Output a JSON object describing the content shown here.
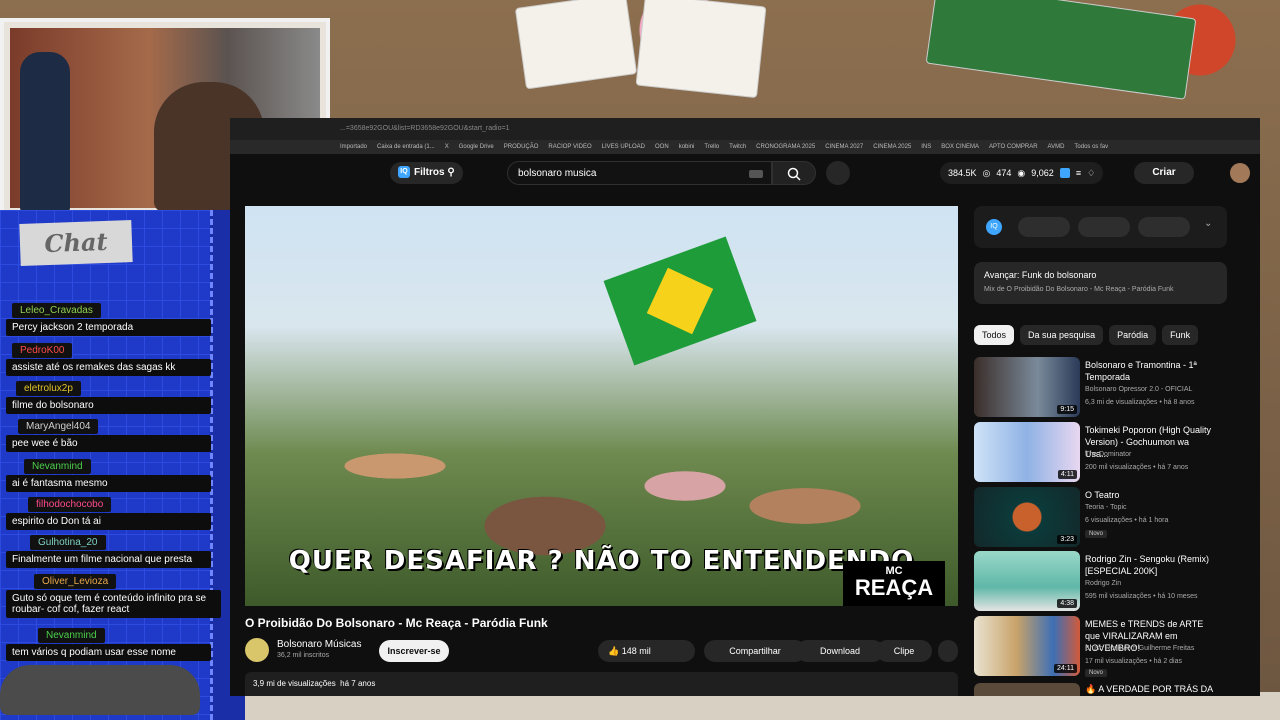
{
  "chat": {
    "title": "Chat",
    "messages": [
      {
        "user": "Leleo_Cravadas",
        "text": "Percy jackson 2 temporada",
        "color": "#8fd14f"
      },
      {
        "user": "PedroK00",
        "text": "assiste até os remakes das sagas kk",
        "color": "#ff4b4b"
      },
      {
        "user": "eletrolux2p",
        "text": "filme do bolsonaro",
        "color": "#e0c22c"
      },
      {
        "user": "MaryAngel404",
        "text": "pee wee é bão",
        "color": "#cfcfcf"
      },
      {
        "user": "Nevanmind",
        "text": "ai é fantasma mesmo",
        "color": "#4bd14b"
      },
      {
        "user": "filhodochocobo",
        "text": "espirito do Don tá ai",
        "color": "#ff4b8c"
      },
      {
        "user": "Gulhotina_20",
        "text": "Finalmente um filme nacional que presta",
        "color": "#7fd1c1"
      },
      {
        "user": "Oliver_Levioza",
        "text": "Guto só oque tem é conteúdo infinito pra se roubar- cof cof, fazer react",
        "color": "#e8a84b"
      },
      {
        "user": "Nevanmind",
        "text": "tem vários q podiam usar esse nome",
        "color": "#4bd14b"
      }
    ]
  },
  "browser": {
    "address": "...=3658e92GOU&list=RD3658e92GOU&start_radio=1",
    "bookmarks": [
      "Importado",
      "Caixa de entrada (1...",
      "X",
      "Google Drive",
      "PRODUÇÃO",
      "RACIOP VIDEO",
      "LIVES UPLOAD",
      "OON",
      "kobini",
      "Trello",
      "Twitch",
      "CRONOGRAMA 2025",
      "CINEMA 2027",
      "CINEMA 2025",
      "INS",
      "BOX CINEMA",
      "APTO COMPRAR",
      "AVMD",
      "Todos os fav"
    ]
  },
  "youtube": {
    "filters_label": "Filtros",
    "search_value": "bolsonaro musica",
    "stats": {
      "views": "384.5K",
      "likes": "474",
      "watching": "9,062"
    },
    "create_label": "Criar",
    "video": {
      "subtitle": "QUER DESAFIAR ? NÃO TO ENTENDENDO",
      "logo_top": "MC",
      "logo_bottom": "REAÇA",
      "title": "O Proibidão Do Bolsonaro - Mc Reaça - Paródia Funk",
      "channel": "Bolsonaro Músicas",
      "subscribers": "36,2 mil inscritos",
      "subscribe_label": "Inscrever-se",
      "likes": "148 mil",
      "share_label": "Compartilhar",
      "download_label": "Download",
      "clip_label": "Clipe",
      "views": "3,9 mi de visualizações",
      "age": "há 7 anos"
    },
    "up_next": {
      "label": "Avançar: Funk do bolsonaro",
      "sub": "Mix de O Proibidão Do Bolsonaro - Mc Reaça - Paródia Funk"
    },
    "chips": [
      "Todos",
      "Da sua pesquisa",
      "Paródia",
      "Funk"
    ],
    "recommendations": [
      {
        "title": "Bolsonaro e Tramontina - 1ª Temporada",
        "channel": "Bolsonaro Opressor 2.0 - OFICIAL",
        "meta": "6,3 mi de visualizações • há 8 anos",
        "duration": "9:15",
        "new": ""
      },
      {
        "title": "Tokimeki Poporon (High Quality Version) - Gochuumon wa Usa...",
        "channel": "The Dominator",
        "meta": "200 mil visualizações • há 7 anos",
        "duration": "4:11",
        "new": ""
      },
      {
        "title": "O Teatro",
        "channel": "Teoria - Topic",
        "meta": "6 visualizações • há 1 hora",
        "duration": "3:23",
        "new": "Novo"
      },
      {
        "title": "Rodrigo Zin - Sengoku (Remix) [ESPECIAL 200K]",
        "channel": "Rodrigo Zin",
        "meta": "595 mil visualizações • há 10 meses",
        "duration": "4:38",
        "new": ""
      },
      {
        "title": "MEMES e TRENDS de ARTE que VIRALIZARAM em NOVEMBRO!",
        "channel": "Brush Rush com Guilherme Freitas",
        "meta": "17 mil visualizações • há 2 dias",
        "duration": "24:11",
        "new": "Novo"
      },
      {
        "title": "A VERDADE POR TRÁS DA",
        "channel": "",
        "meta": "",
        "duration": "",
        "new": ""
      }
    ]
  },
  "colors": {
    "accent": "#3ea6ff",
    "background": "#0f0f0f",
    "chat_blue": "#1f39c9"
  }
}
